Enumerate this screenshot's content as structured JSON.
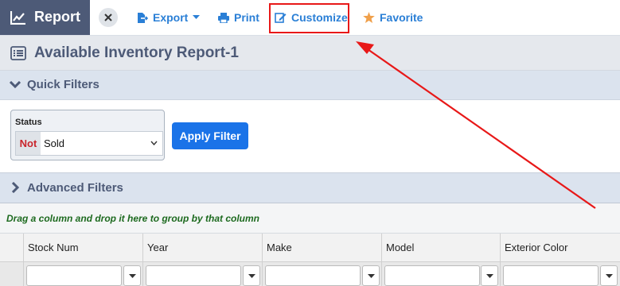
{
  "brand": {
    "title": "Report"
  },
  "toolbar": {
    "export_label": "Export",
    "print_label": "Print",
    "customize_label": "Customize",
    "favorite_label": "Favorite"
  },
  "page": {
    "title": "Available Inventory Report-1"
  },
  "quick_filters": {
    "label": "Quick Filters",
    "status": {
      "label": "Status",
      "negate": "Not",
      "value": "Sold"
    },
    "apply_label": "Apply Filter"
  },
  "advanced_filters": {
    "label": "Advanced Filters"
  },
  "grid": {
    "group_hint": "Drag a column and drop it here to group by that column",
    "columns": [
      "Stock Num",
      "Year",
      "Make",
      "Model",
      "Exterior Color"
    ]
  },
  "colors": {
    "brand_bg": "#4d5a77",
    "accent": "#2a7fd6",
    "apply_button": "#1a73e8",
    "annotation": "#e81818",
    "favorite_star": "#f0a04b"
  }
}
